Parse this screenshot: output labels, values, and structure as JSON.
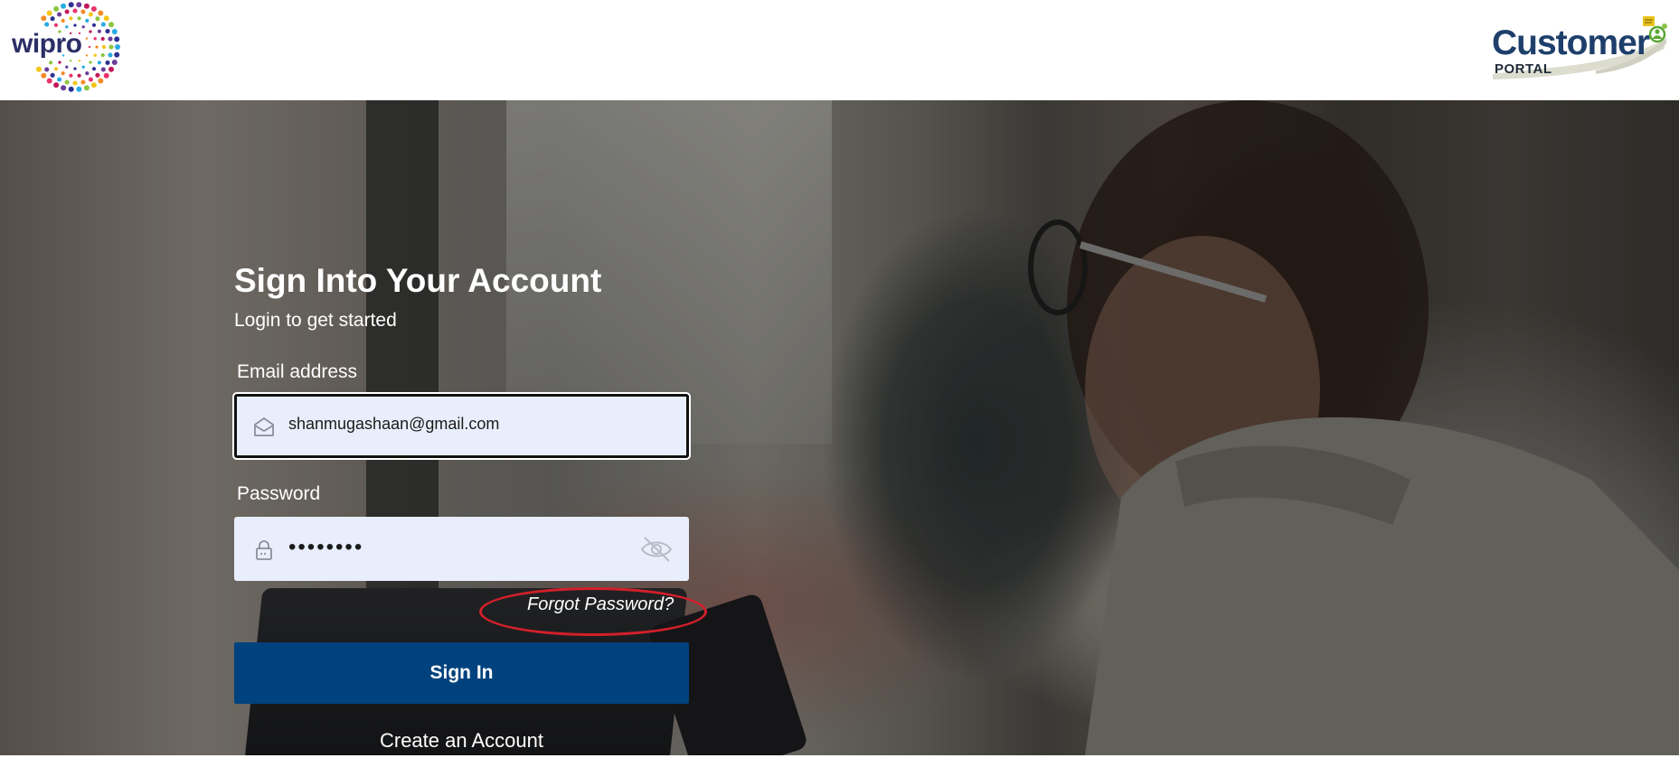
{
  "header": {
    "wipro_logo_text": "wipro",
    "portal_logo": {
      "title": "Customer",
      "subtitle": "PORTAL"
    }
  },
  "login": {
    "title": "Sign Into Your Account",
    "subtitle": "Login to get started",
    "email": {
      "label": "Email address",
      "value": "shanmugashaan@gmail.com",
      "icon": "envelope-icon"
    },
    "password": {
      "label": "Password",
      "value": "••••••••",
      "icon": "lock-icon",
      "toggle_icon": "eye-slash-icon"
    },
    "forgot_password": "Forgot Password?",
    "sign_in_button": "Sign In",
    "create_account": "Create an Account"
  },
  "colors": {
    "primary_button": "#00427e",
    "input_background": "#e8eefb",
    "annotation_ring": "#d2202a",
    "portal_logo_text": "#1e3f6b",
    "wipro_text": "#2b2f66"
  }
}
